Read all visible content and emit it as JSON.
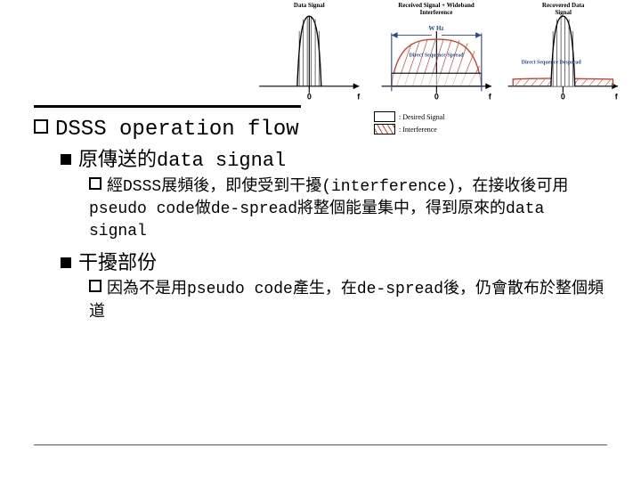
{
  "diagrams": {
    "d1_title": "Data Signal",
    "d2_title": "Received Signal +\nWideband Interference",
    "d2_width": "W Hz",
    "d2_inner": "Direct Sequence\nSpread",
    "d3_title": "Recovered\nData Signal",
    "d3_inner": "Direct Sequence\nDespread",
    "axis_o": "0",
    "axis_f": "f"
  },
  "legend": {
    "desired": ": Desired Signal",
    "interference": ": Interference"
  },
  "outline": {
    "l1": "DSSS operation flow",
    "l2a": "原傳送的data signal",
    "l3a": "經DSSS展頻後，即使受到干擾(interference)，在接收後可用pseudo code做de-spread將整個能量集中，得到原來的data signal",
    "l2b": "干擾部份",
    "l3b": "因為不是用pseudo code產生，在de-spread後，仍會散布於整個頻道"
  }
}
